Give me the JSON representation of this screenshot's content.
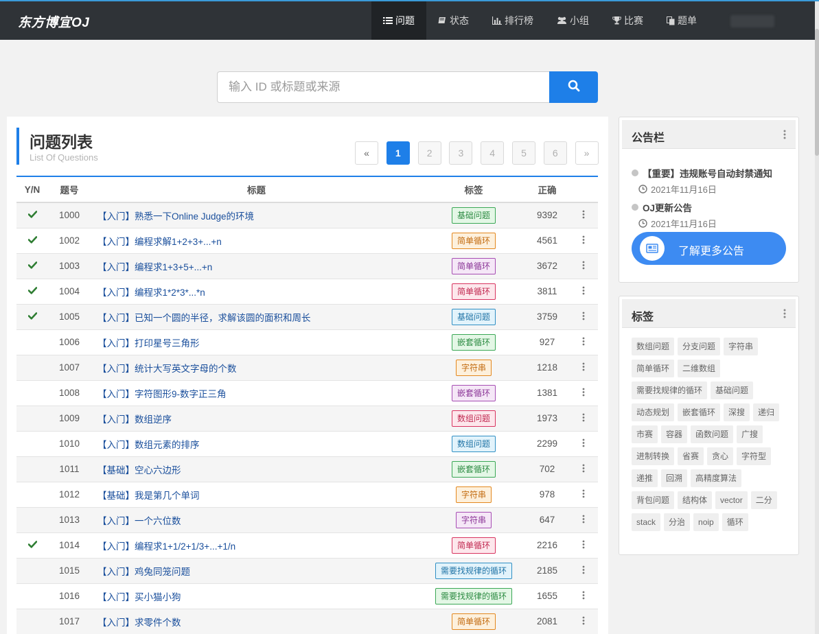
{
  "brand": "东方博宜OJ",
  "nav": [
    {
      "label": "问题",
      "icon": "list-icon",
      "active": true
    },
    {
      "label": "状态",
      "icon": "book-icon",
      "active": false
    },
    {
      "label": "排行榜",
      "icon": "bar-chart-icon",
      "active": false
    },
    {
      "label": "小组",
      "icon": "users-icon",
      "active": false
    },
    {
      "label": "比赛",
      "icon": "trophy-icon",
      "active": false
    },
    {
      "label": "题单",
      "icon": "copy-icon",
      "active": false
    }
  ],
  "search": {
    "placeholder": "输入 ID 或标题或来源",
    "value": "",
    "button_icon": "search-icon"
  },
  "problems": {
    "title": "问题列表",
    "subtitle": "List Of Questions",
    "pagination": {
      "prev": "«",
      "next": "»",
      "pages": [
        "1",
        "2",
        "3",
        "4",
        "5",
        "6"
      ],
      "current": "1"
    },
    "columns": [
      "Y/N",
      "题号",
      "标题",
      "标签",
      "正确"
    ],
    "rows": [
      {
        "solved": true,
        "id": "1000",
        "title": "【入门】熟悉一下Online Judge的环境",
        "tag": "基础问题",
        "tag_color": "green",
        "accepted": "9392"
      },
      {
        "solved": true,
        "id": "1002",
        "title": "【入门】编程求解1+2+3+...+n",
        "tag": "简单循环",
        "tag_color": "orange",
        "accepted": "4561"
      },
      {
        "solved": true,
        "id": "1003",
        "title": "【入门】编程求1+3+5+...+n",
        "tag": "简单循环",
        "tag_color": "purple",
        "accepted": "3672"
      },
      {
        "solved": true,
        "id": "1004",
        "title": "【入门】编程求1*2*3*...*n",
        "tag": "简单循环",
        "tag_color": "crimson",
        "accepted": "3811"
      },
      {
        "solved": true,
        "id": "1005",
        "title": "【入门】已知一个圆的半径，求解该圆的面积和周长",
        "tag": "基础问题",
        "tag_color": "blue",
        "accepted": "3759"
      },
      {
        "solved": false,
        "id": "1006",
        "title": "【入门】打印星号三角形",
        "tag": "嵌套循环",
        "tag_color": "green",
        "accepted": "927"
      },
      {
        "solved": false,
        "id": "1007",
        "title": "【入门】统计大写英文字母的个数",
        "tag": "字符串",
        "tag_color": "orange",
        "accepted": "1218"
      },
      {
        "solved": false,
        "id": "1008",
        "title": "【入门】字符图形9-数字正三角",
        "tag": "嵌套循环",
        "tag_color": "purple",
        "accepted": "1381"
      },
      {
        "solved": false,
        "id": "1009",
        "title": "【入门】数组逆序",
        "tag": "数组问题",
        "tag_color": "crimson",
        "accepted": "1973"
      },
      {
        "solved": false,
        "id": "1010",
        "title": "【入门】数组元素的排序",
        "tag": "数组问题",
        "tag_color": "blue",
        "accepted": "2299"
      },
      {
        "solved": false,
        "id": "1011",
        "title": "【基础】空心六边形",
        "tag": "嵌套循环",
        "tag_color": "green",
        "accepted": "702"
      },
      {
        "solved": false,
        "id": "1012",
        "title": "【基础】我是第几个单词",
        "tag": "字符串",
        "tag_color": "orange",
        "accepted": "978"
      },
      {
        "solved": false,
        "id": "1013",
        "title": "【入门】一个六位数",
        "tag": "字符串",
        "tag_color": "purple",
        "accepted": "647"
      },
      {
        "solved": true,
        "id": "1014",
        "title": "【入门】编程求1+1/2+1/3+...+1/n",
        "tag": "简单循环",
        "tag_color": "crimson",
        "accepted": "2216"
      },
      {
        "solved": false,
        "id": "1015",
        "title": "【入门】鸡兔同笼问题",
        "tag": "需要找规律的循环",
        "tag_color": "blue",
        "accepted": "2185"
      },
      {
        "solved": false,
        "id": "1016",
        "title": "【入门】买小猫小狗",
        "tag": "需要找规律的循环",
        "tag_color": "green",
        "accepted": "1655"
      },
      {
        "solved": false,
        "id": "1017",
        "title": "【入门】求零件个数",
        "tag": "简单循环",
        "tag_color": "orange",
        "accepted": "2081"
      }
    ]
  },
  "notices": {
    "title": "公告栏",
    "items": [
      {
        "title": "【重要】违规账号自动封禁通知",
        "date": "2021年11月16日"
      },
      {
        "title": "OJ更新公告",
        "date": "2021年11月16日"
      }
    ],
    "more_label": "了解更多公告"
  },
  "tags": {
    "title": "标签",
    "items": [
      "数组问题",
      "分支问题",
      "字符串",
      "简单循环",
      "二维数组",
      "需要找规律的循环",
      "基础问题",
      "动态规划",
      "嵌套循环",
      "深搜",
      "递归",
      "市赛",
      "容器",
      "函数问题",
      "广搜",
      "进制转换",
      "省赛",
      "贪心",
      "字符型",
      "递推",
      "回溯",
      "高精度算法",
      "背包问题",
      "结构体",
      "vector",
      "二分",
      "stack",
      "分治",
      "noip",
      "循环"
    ]
  },
  "colors": {
    "accent": "#1e7fe8",
    "navbar": "#2f3337",
    "check": "#2e7d32"
  }
}
